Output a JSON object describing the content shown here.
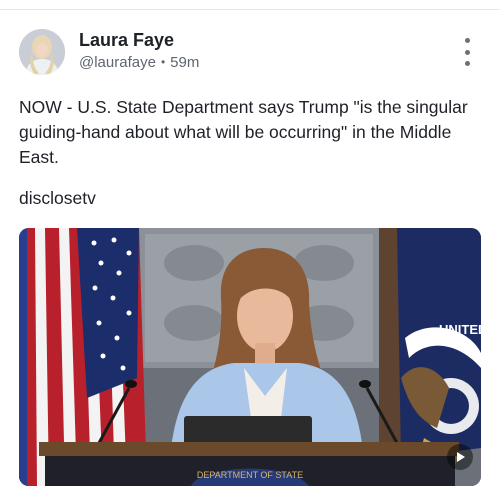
{
  "post": {
    "author": {
      "name": "Laura Faye",
      "handle": "@laurafaye",
      "separator": "•",
      "time": "59m"
    },
    "text": "NOW - U.S. State Department says Trump \"is the singular guiding-hand about what will be occurring\" in the Middle East.",
    "source": "disclosetv",
    "media": {
      "type": "video",
      "podium_seal_text": "DEPARTMENT OF STATE",
      "flag_tag_text": "UNITED STATES"
    }
  },
  "icons": {
    "avatar": "avatar",
    "more": "more-vertical-icon",
    "play": "play-icon"
  }
}
